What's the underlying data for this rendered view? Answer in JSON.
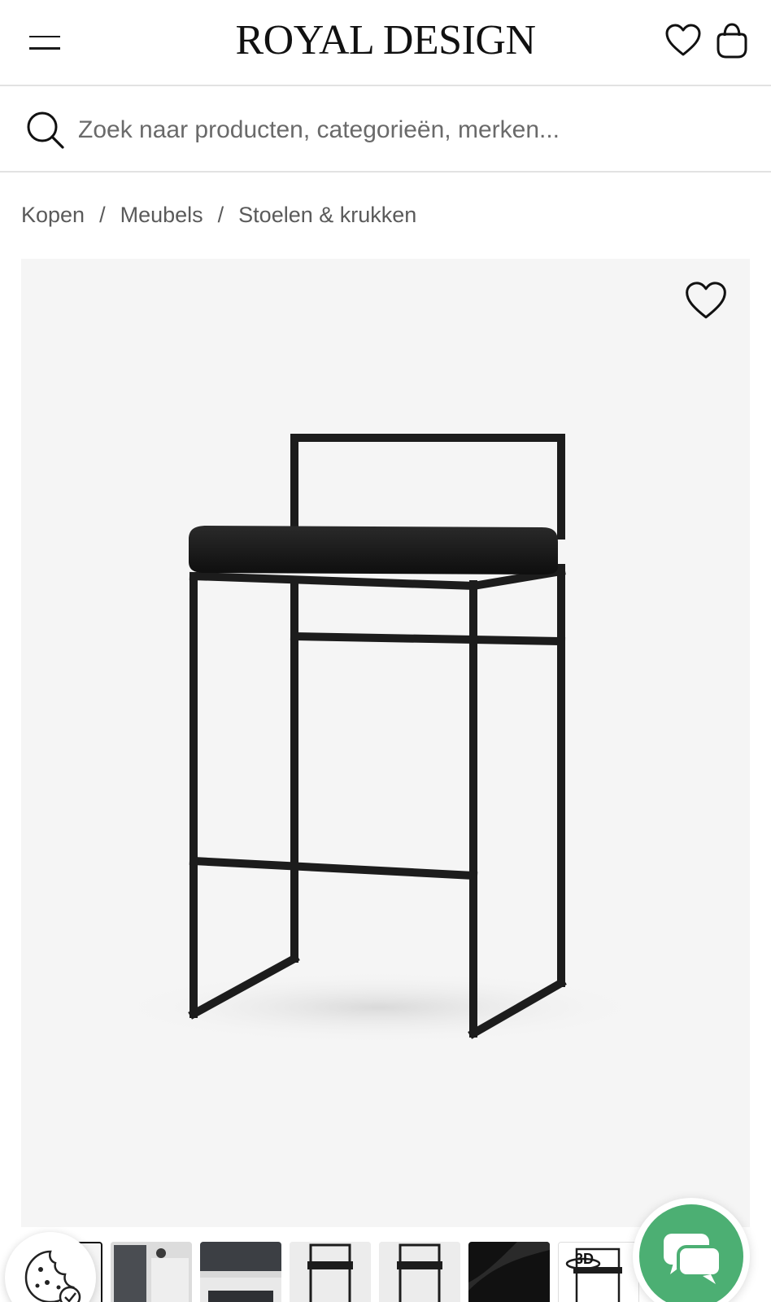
{
  "header": {
    "logo": "ROYAL DESIGN",
    "menu_icon": "hamburger-menu-icon",
    "favorites_icon": "heart-icon",
    "cart_icon": "shopping-bag-icon"
  },
  "search": {
    "placeholder": "Zoek naar producten, categorieën, merken...",
    "value": "",
    "icon": "search-icon"
  },
  "breadcrumb": {
    "items": [
      "Kopen",
      "Meubels",
      "Stoelen & krukken"
    ],
    "separator": "/"
  },
  "gallery": {
    "favorite_icon": "heart-outline-icon",
    "main_image": "black-bar-stool-product-image",
    "thumbnails": [
      {
        "icon": "bar-stool-thumbnail",
        "active": true
      },
      {
        "icon": "kitchen-scene-thumbnail"
      },
      {
        "icon": "dark-kitchen-thumbnail"
      },
      {
        "icon": "bar-stool-front-thumbnail"
      },
      {
        "icon": "bar-stool-side-thumbnail"
      },
      {
        "icon": "black-leather-detail-thumbnail"
      },
      {
        "icon": "3d-view-thumbnail",
        "label": "3D"
      }
    ]
  },
  "floating": {
    "cookie_icon": "cookie-settings-icon",
    "chat_icon": "chat-bubbles-icon"
  },
  "colors": {
    "accent_chat": "#4caf73",
    "text": "#1a1a1a",
    "muted": "#5a5a5a",
    "divider": "#e2e2e2",
    "image_bg": "#f5f5f5"
  }
}
